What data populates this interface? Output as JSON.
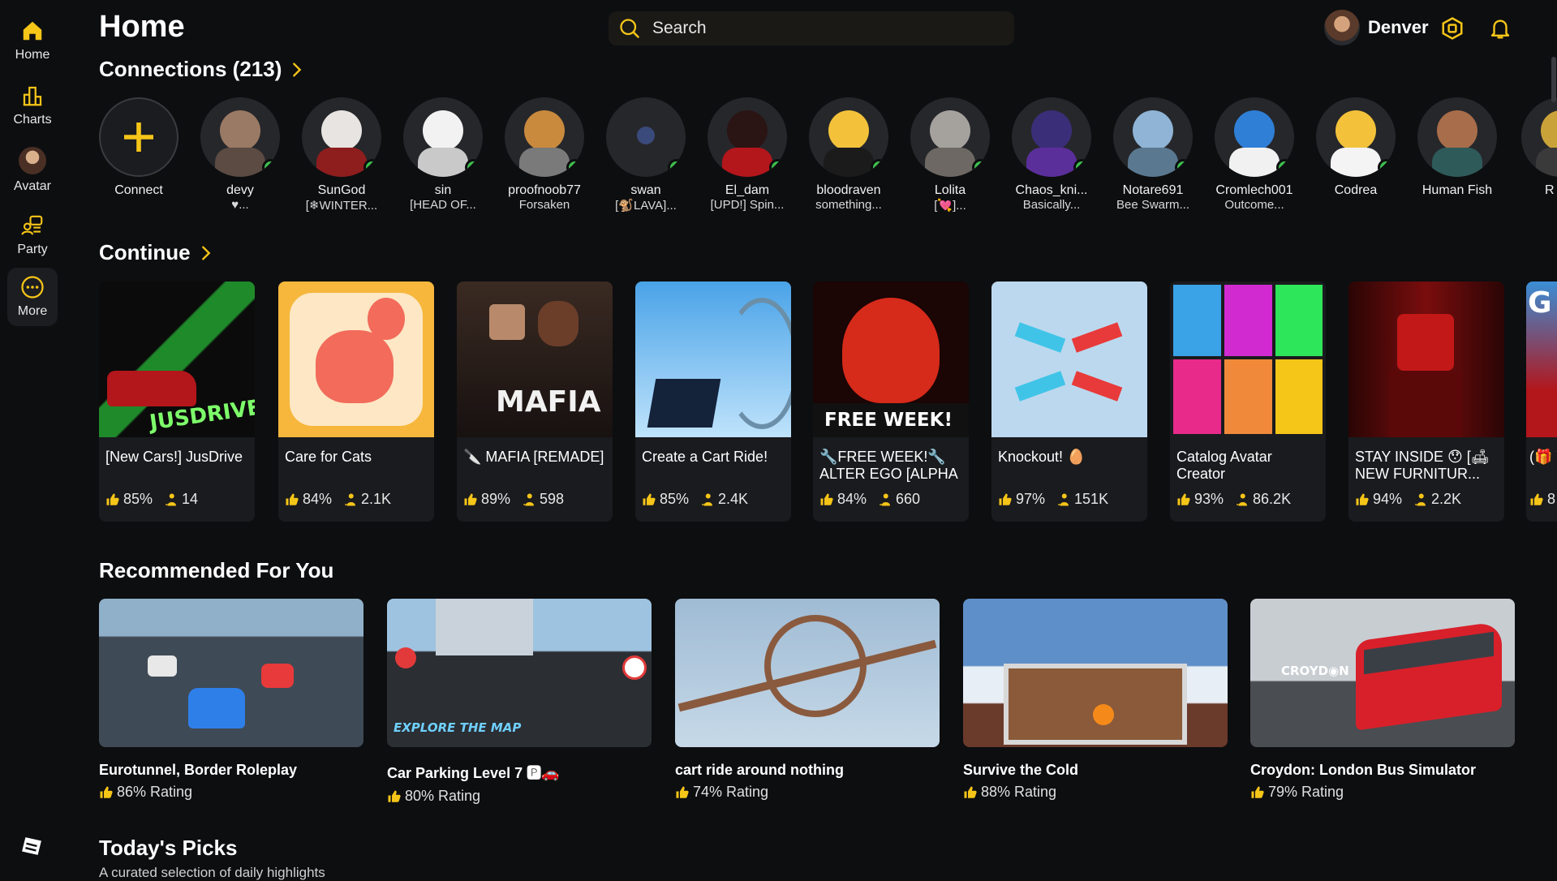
{
  "colors": {
    "accent": "#f5c518",
    "online": "#3ec04e",
    "card": "#1a1b1e",
    "background": "#0d0e10"
  },
  "sidebar": {
    "items": [
      {
        "label": "Home",
        "icon": "home-icon"
      },
      {
        "label": "Charts",
        "icon": "charts-icon"
      },
      {
        "label": "Avatar",
        "icon": "avatar-icon"
      },
      {
        "label": "Party",
        "icon": "party-icon"
      },
      {
        "label": "More",
        "icon": "more-icon"
      }
    ]
  },
  "header": {
    "title": "Home",
    "search_placeholder": "Search",
    "username": "Denver"
  },
  "connections": {
    "heading": "Connections (213)",
    "connect_label": "Connect",
    "friends": [
      {
        "name": "devy",
        "status": "♥..."
      },
      {
        "name": "SunGod",
        "status": "[❄WINTER..."
      },
      {
        "name": "sin",
        "status": "[HEAD OF..."
      },
      {
        "name": "proofnoob77",
        "status": "Forsaken"
      },
      {
        "name": "swan",
        "status": "[🐒LAVA]..."
      },
      {
        "name": "El_dam",
        "status": "[UPD!] Spin..."
      },
      {
        "name": "bloodraven",
        "status": "something..."
      },
      {
        "name": "Lolita",
        "status": "[💘]..."
      },
      {
        "name": "Chaos_kni...",
        "status": "Basically..."
      },
      {
        "name": "Notare691",
        "status": "Bee Swarm..."
      },
      {
        "name": "Cromlech001",
        "status": "Outcome..."
      },
      {
        "name": "Codrea",
        "status": ""
      },
      {
        "name": "Human Fish",
        "status": ""
      },
      {
        "name": "R",
        "status": ""
      }
    ]
  },
  "continue": {
    "heading": "Continue",
    "games": [
      {
        "title": "[New Cars!] JusDrive",
        "rating": "85%",
        "players": "14",
        "thumb_text": "JUSDRIVE"
      },
      {
        "title": "Care for Cats",
        "rating": "84%",
        "players": "2.1K",
        "thumb_text": ""
      },
      {
        "title": "🔪 MAFIA [REMADE]",
        "rating": "89%",
        "players": "598",
        "thumb_text": "MAFIA"
      },
      {
        "title": "Create a Cart Ride!",
        "rating": "85%",
        "players": "2.4K",
        "thumb_text": ""
      },
      {
        "title": "🔧FREE WEEK!🔧 ALTER EGO [ALPHA",
        "rating": "84%",
        "players": "660",
        "thumb_text": "FREE WEEK!"
      },
      {
        "title": "Knockout! 🥚",
        "rating": "97%",
        "players": "151K",
        "thumb_text": ""
      },
      {
        "title": "Catalog Avatar Creator",
        "rating": "93%",
        "players": "86.2K",
        "thumb_text": ""
      },
      {
        "title": "STAY INSIDE 😯 [🛋NEW FURNITUR...",
        "rating": "94%",
        "players": "2.2K",
        "thumb_text": ""
      },
      {
        "title": "(🎁 YEA",
        "rating": "8",
        "players": "",
        "thumb_text": "G"
      }
    ]
  },
  "recommended": {
    "heading": "Recommended For You",
    "games": [
      {
        "title": "Eurotunnel, Border Roleplay",
        "rating": "86% Rating",
        "thumb_text": ""
      },
      {
        "title": "Car Parking Level 7 🅿🚗",
        "rating": "80% Rating",
        "thumb_text": "EXPLORE THE MAP"
      },
      {
        "title": "cart ride around nothing",
        "rating": "74% Rating",
        "thumb_text": ""
      },
      {
        "title": "Survive the Cold",
        "rating": "88% Rating",
        "thumb_text": ""
      },
      {
        "title": "Croydon: London Bus Simulator",
        "rating": "79% Rating",
        "thumb_text": "CROYD◉N"
      }
    ]
  },
  "todays_picks": {
    "heading": "Today's Picks",
    "subtitle": "A curated selection of daily highlights"
  }
}
